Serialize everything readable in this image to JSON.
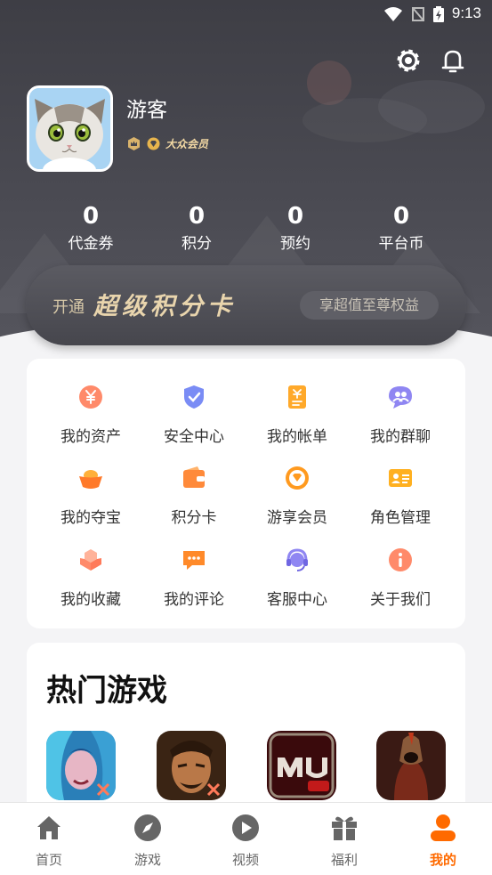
{
  "status_bar": {
    "time": "9:13"
  },
  "user": {
    "name": "游客",
    "member_level": "大众会员"
  },
  "stats": [
    {
      "value": "0",
      "label": "代金券"
    },
    {
      "value": "0",
      "label": "积分"
    },
    {
      "value": "0",
      "label": "预约"
    },
    {
      "value": "0",
      "label": "平台币"
    }
  ],
  "promo": {
    "open_label": "开通",
    "title": "超级积分卡",
    "button_label": "享超值至尊权益"
  },
  "menu": [
    {
      "label": "我的资产",
      "icon": "yuan-coin-icon"
    },
    {
      "label": "安全中心",
      "icon": "shield-check-icon"
    },
    {
      "label": "我的帐单",
      "icon": "bill-icon"
    },
    {
      "label": "我的群聊",
      "icon": "group-chat-icon"
    },
    {
      "label": "我的夺宝",
      "icon": "gold-ingot-icon"
    },
    {
      "label": "积分卡",
      "icon": "wallet-icon"
    },
    {
      "label": "游享会员",
      "icon": "vip-diamond-icon"
    },
    {
      "label": "角色管理",
      "icon": "id-card-icon"
    },
    {
      "label": "我的收藏",
      "icon": "cubes-icon"
    },
    {
      "label": "我的评论",
      "icon": "comment-icon"
    },
    {
      "label": "客服中心",
      "icon": "headset-icon"
    },
    {
      "label": "关于我们",
      "icon": "info-icon"
    }
  ],
  "hot_games": {
    "title": "热门游戏"
  },
  "bottom_nav": [
    {
      "label": "首页",
      "icon": "home-icon"
    },
    {
      "label": "游戏",
      "icon": "compass-icon"
    },
    {
      "label": "视频",
      "icon": "play-icon"
    },
    {
      "label": "福利",
      "icon": "gift-icon"
    },
    {
      "label": "我的",
      "icon": "profile-icon",
      "active": true
    }
  ],
  "colors": {
    "accent": "#ff6a00",
    "header": "#46464d",
    "gold": "#e9d5ad"
  }
}
